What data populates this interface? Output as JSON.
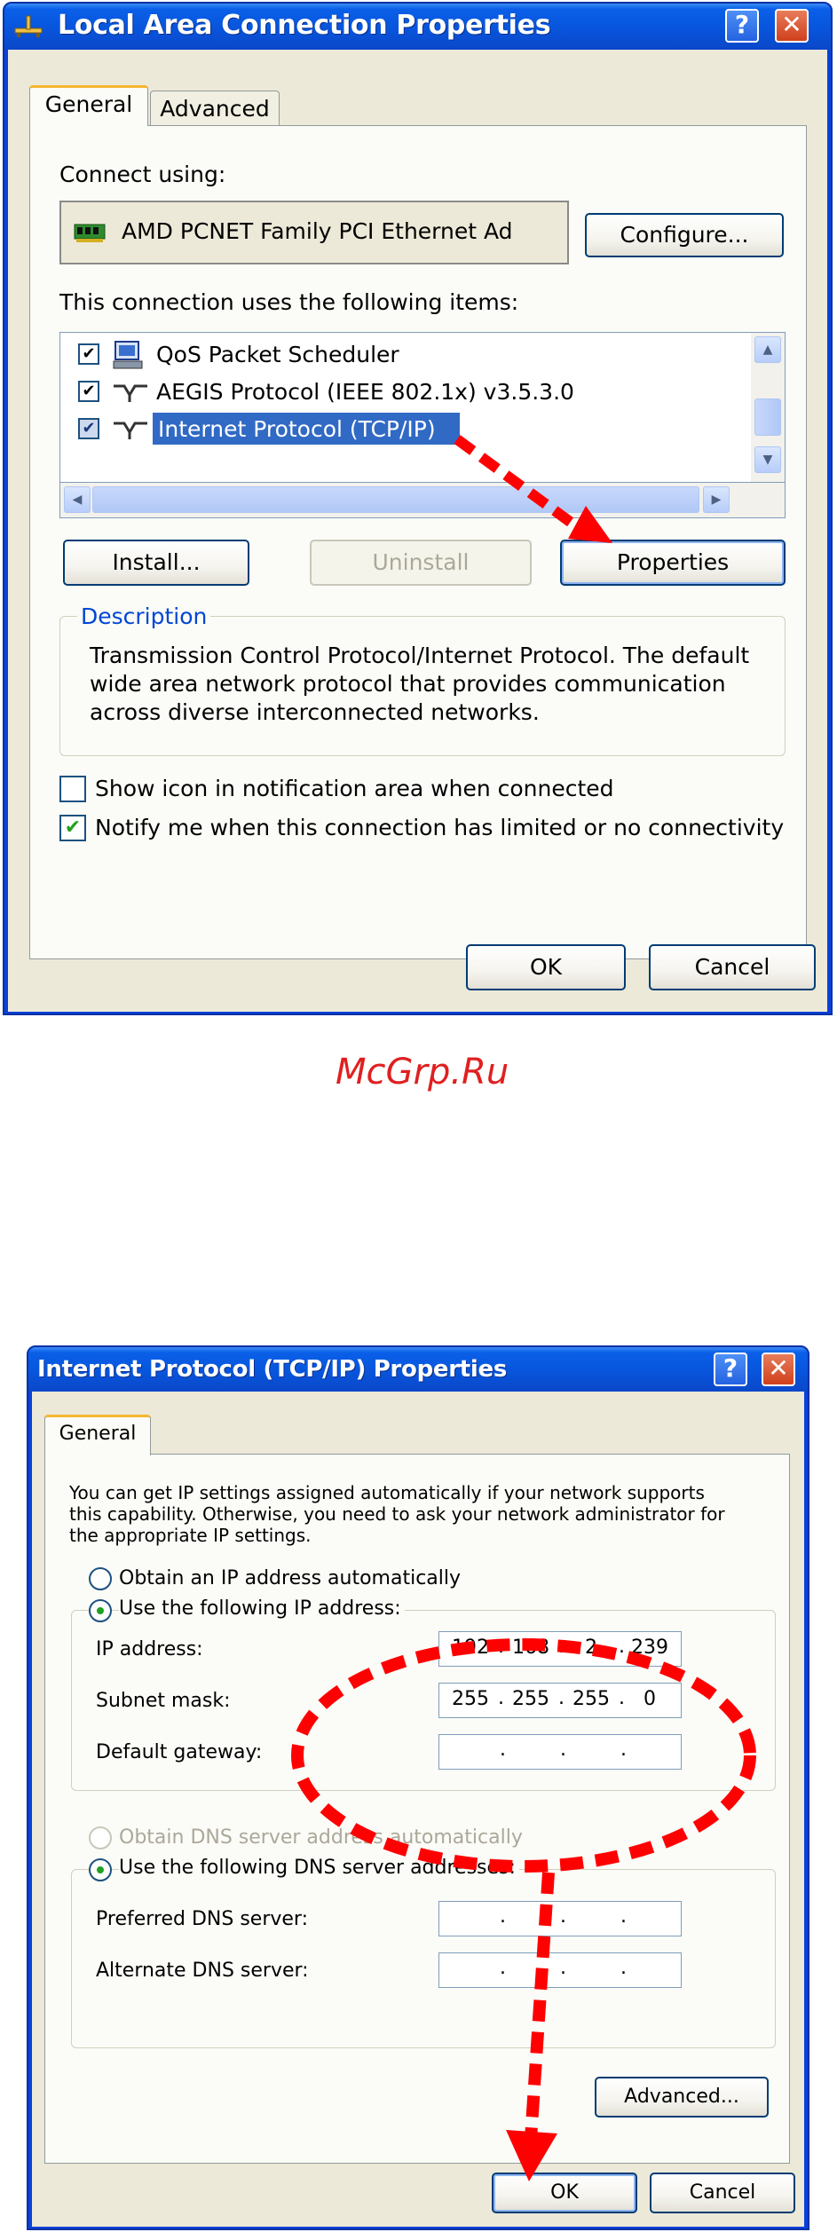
{
  "window1": {
    "title": "Local Area Connection Properties",
    "tabs": [
      "General",
      "Advanced"
    ],
    "connect_using_label": "Connect using:",
    "adapter_name": "AMD PCNET Family PCI Ethernet Ad",
    "configure_button": "Configure...",
    "items_label": "This connection uses the following items:",
    "items": [
      {
        "label": "QoS Packet Scheduler",
        "checked": true,
        "icon": "scheduler-icon"
      },
      {
        "label": "AEGIS Protocol (IEEE 802.1x) v3.5.3.0",
        "checked": true,
        "icon": "protocol-icon"
      },
      {
        "label": "Internet Protocol (TCP/IP)",
        "checked": true,
        "icon": "protocol-icon",
        "selected": true
      }
    ],
    "install_button": "Install...",
    "uninstall_button": "Uninstall",
    "properties_button": "Properties",
    "description_title": "Description",
    "description_line1": "Transmission Control Protocol/Internet Protocol. The default",
    "description_line2": "wide area network protocol that provides communication",
    "description_line3": "across diverse interconnected networks.",
    "show_icon_label": "Show icon in notification area when connected",
    "show_icon_checked": false,
    "notify_label": "Notify me when this connection has limited or no connectivity",
    "notify_checked": true,
    "ok_button": "OK",
    "cancel_button": "Cancel"
  },
  "watermark": "McGrp.Ru",
  "window2": {
    "title": "Internet Protocol (TCP/IP) Properties",
    "tab": "General",
    "intro_line1": "You can get IP settings assigned automatically if your network supports",
    "intro_line2": "this capability. Otherwise, you need to ask your network administrator for",
    "intro_line3": "the appropriate IP settings.",
    "obtain_ip_auto": "Obtain an IP address automatically",
    "use_following_ip": "Use the following IP address:",
    "ip_label": "IP address:",
    "ip_value": [
      "192",
      "168",
      "2",
      "239"
    ],
    "subnet_label": "Subnet mask:",
    "subnet_value": [
      "255",
      "255",
      "255",
      "0"
    ],
    "gateway_label": "Default gateway:",
    "obtain_dns_auto": "Obtain DNS server address automatically",
    "use_following_dns": "Use the following DNS server addresses:",
    "preferred_dns_label": "Preferred DNS server:",
    "alternate_dns_label": "Alternate DNS server:",
    "advanced_button": "Advanced...",
    "ok_button": "OK",
    "cancel_button": "Cancel"
  },
  "colors": {
    "title_bar": "#0a5fe8",
    "dialog_bg": "#ece9d8",
    "selection": "#316ac5",
    "annotation_red": "#ff0000",
    "watermark_red": "#e02020",
    "check_green": "#21a121"
  }
}
